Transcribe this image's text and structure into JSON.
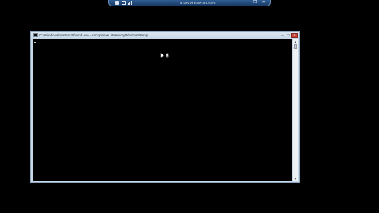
{
  "remote_bar": {
    "title": "IE Dev vs EMW-IE1 SVR1",
    "minimize_glyph": "–",
    "restore_glyph": "❐",
    "close_glyph": "✕",
    "icons": [
      "pin-icon",
      "lock-icon",
      "signal-icon"
    ]
  },
  "console": {
    "title": "C:\\Windows\\system32\\cmd.exe - cscript.exe  .\\MemoryWindowStamp",
    "minimize_glyph": "–",
    "maximize_glyph": "□",
    "close_glyph": "×",
    "scroll_up_glyph": "▲",
    "scroll_down_glyph": "▼",
    "text": ""
  },
  "colors": {
    "desktop": "#000000",
    "remote_bar": "#1f4a7c",
    "window_frame": "#c9d8e6",
    "close_button": "#c4453a"
  }
}
